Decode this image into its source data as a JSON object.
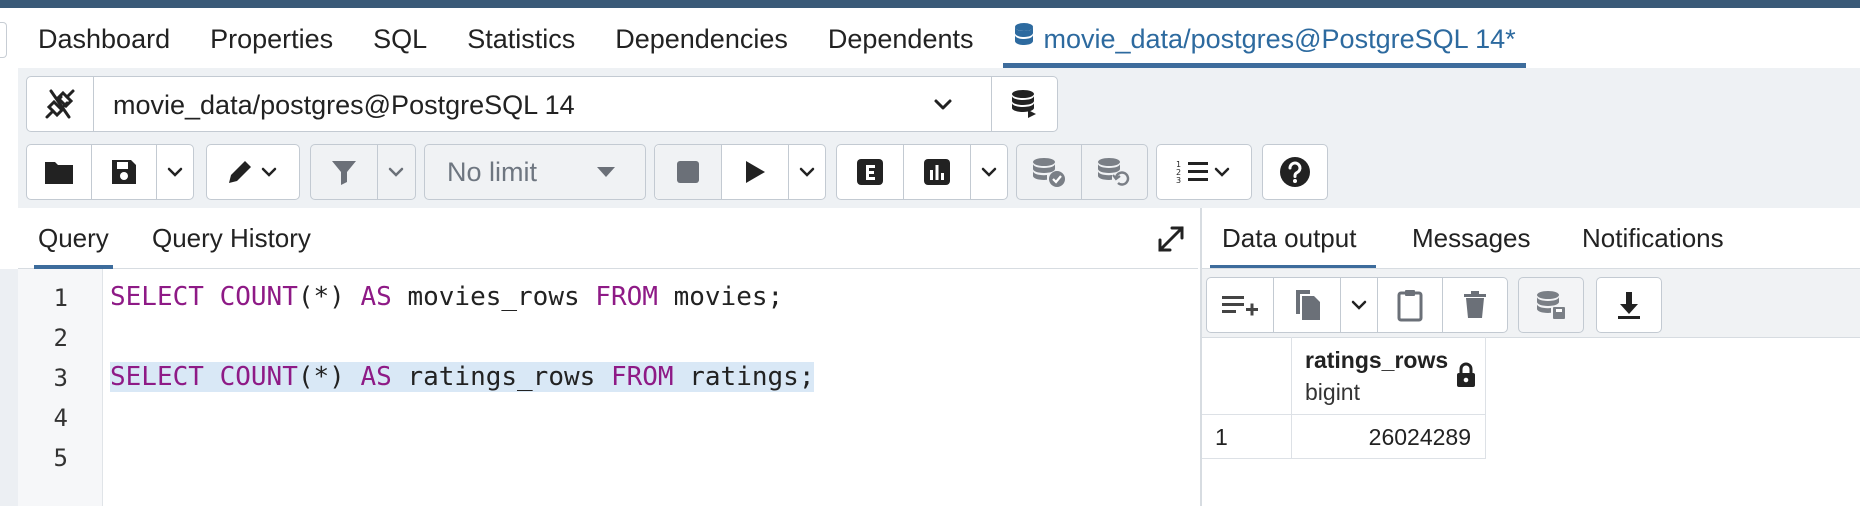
{
  "main_tabs": [
    {
      "label": "Dashboard"
    },
    {
      "label": "Properties"
    },
    {
      "label": "SQL"
    },
    {
      "label": "Statistics"
    },
    {
      "label": "Dependencies"
    },
    {
      "label": "Dependents"
    },
    {
      "label": "movie_data/postgres@PostgreSQL 14*",
      "active": true,
      "icon": "database-icon"
    }
  ],
  "toolbar": {
    "connection": "movie_data/postgres@PostgreSQL 14",
    "limit": "No limit",
    "icons": [
      "plug-icon",
      "chevron-down-icon",
      "database-stack-icon",
      "open-folder-icon",
      "save-icon",
      "edit-pencil-icon",
      "filter-icon",
      "stop-icon",
      "play-icon",
      "explain-icon",
      "explain-analyze-icon",
      "commit-icon",
      "rollback-icon",
      "macros-icon",
      "help-icon"
    ]
  },
  "editor": {
    "tabs": [
      {
        "label": "Query",
        "active": true
      },
      {
        "label": "Query History"
      }
    ],
    "line_numbers": [
      "1",
      "2",
      "3",
      "4",
      "5"
    ],
    "lines": [
      {
        "kw1": "SELECT",
        "fn": "COUNT",
        "arg": "(*)",
        "kw2": "AS",
        "alias": "movies_rows",
        "kw3": "FROM",
        "table": "movies",
        "end": ";"
      },
      {
        "kw1": "SELECT",
        "fn": "COUNT",
        "arg": "(*)",
        "kw2": "AS",
        "alias": "ratings_rows",
        "kw3": "FROM",
        "table": "ratings",
        "end": ";"
      }
    ]
  },
  "output": {
    "tabs": [
      {
        "label": "Data output",
        "active": true
      },
      {
        "label": "Messages"
      },
      {
        "label": "Notifications"
      }
    ],
    "columns": [
      {
        "name": "ratings_rows",
        "type": "bigint",
        "locked": true
      }
    ],
    "rows": [
      {
        "index": "1",
        "values": [
          "26024289"
        ]
      }
    ]
  },
  "colors": {
    "accent": "#3d6c9c",
    "keyword": "#8e1a86",
    "highlight": "#d9e8f6",
    "top_bar": "#3a5a78"
  }
}
